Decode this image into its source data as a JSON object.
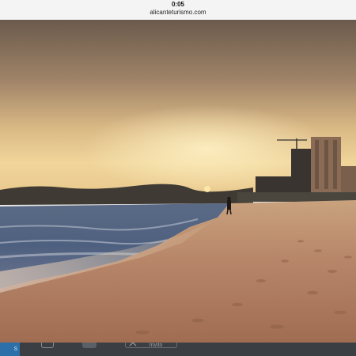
{
  "status_bar": {
    "time": "0:05",
    "url": "alicanteturismo.com"
  },
  "photo": {
    "subject": "beach-at-sunset-photo",
    "colors": {
      "sky_top": "#6b5a4c",
      "sky_glow": "#f0d59a",
      "sea": "#4e607f",
      "sand": "#b07a5c",
      "toolbar": "#3b3f44",
      "badge": "#2d6fa8"
    }
  },
  "toolbar": {
    "badge_text": "S",
    "share_label": "Invito",
    "icons": [
      "chat-icon",
      "gallery-icon",
      "share-icon"
    ]
  }
}
